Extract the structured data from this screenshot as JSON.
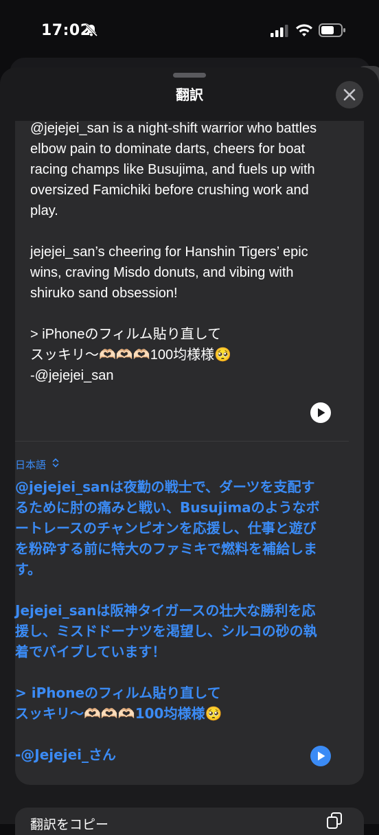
{
  "status_bar": {
    "time": "17:02"
  },
  "sheet": {
    "title": "翻訳"
  },
  "source": {
    "paragraphs": [
      "@jejejei_san is a night-shift warrior who battles elbow pain to dominate darts, cheers for boat racing champs like Busujima, and fuels up with oversized Famichiki before crushing work and play.",
      "jejejei_san’s cheering for Hanshin Tigers’ epic wins, craving Misdo donuts, and vibing with shiruko sand obsession!",
      "> iPhoneのフィルム貼り直して",
      "スッキリ〜🫶🏻🫶🏻🫶🏻100均様様🥺",
      "-@jejejei_san"
    ]
  },
  "target": {
    "language": "日本語",
    "paragraphs": [
      "@jejejei_sanは夜勤の戦士で、ダーツを支配するために肘の痛みと戦い、Busujimaのようなボートレースのチャンピオンを応援し、仕事と遊びを粉砕する前に特大のファミキで燃料を補給します。",
      "Jejejei_sanは阪神タイガースの壮大な勝利を応援し、ミスドドーナツを渇望し、シルコの砂の執着でバイブしています！",
      "> iPhoneのフィルム貼り直して",
      "スッキリ〜🫶🏻🫶🏻🫶🏻100均様様🥺",
      "-@Jejejei_さん"
    ]
  },
  "bottom_bar": {
    "copy_label": "翻訳をコピー"
  },
  "colors": {
    "accent": "#3b8bf5",
    "sheet": "#1b1b1d",
    "card": "#2b2b2d"
  }
}
